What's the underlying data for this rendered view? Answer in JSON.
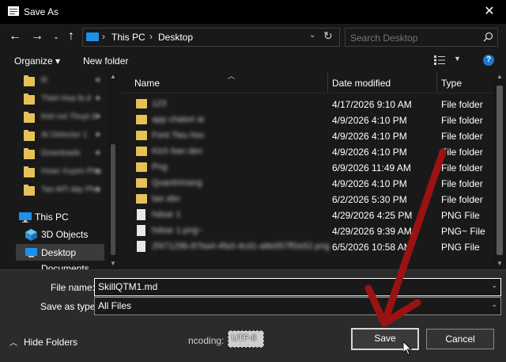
{
  "window": {
    "title": "Save As"
  },
  "nav": {
    "breadcrumb": [
      "This PC",
      "Desktop"
    ],
    "search_placeholder": "Search Desktop"
  },
  "toolbar": {
    "organize": "Organize ▾",
    "new_folder": "New folder"
  },
  "sidebar": {
    "quick_access": [
      {
        "label": "fiI"
      },
      {
        "label": "Thiet Hoa fa d"
      },
      {
        "label": "Kiet noi Thuyt d"
      },
      {
        "label": "AI Detector 1"
      },
      {
        "label": "Downloads"
      },
      {
        "label": "Hoan Xuyen Phu"
      },
      {
        "label": "Tao API day Phu"
      }
    ],
    "items": [
      {
        "label": "This PC",
        "icon": "monitor-icon"
      },
      {
        "label": "3D Objects",
        "icon": "cube-icon"
      },
      {
        "label": "Desktop",
        "icon": "desktop-icon",
        "selected": true
      },
      {
        "label": "Documents",
        "icon": "documents-icon"
      }
    ]
  },
  "list": {
    "columns": [
      "Name",
      "Date modified",
      "Type"
    ],
    "rows": [
      {
        "name": "123",
        "date": "4/17/2026 9:10 AM",
        "type": "File folder",
        "icon": "folder-icon"
      },
      {
        "name": "app chatori ai",
        "date": "4/9/2026 4:10 PM",
        "type": "File folder",
        "icon": "folder-icon"
      },
      {
        "name": "Font Tieu hoc",
        "date": "4/9/2026 4:10 PM",
        "type": "File folder",
        "icon": "folder-icon"
      },
      {
        "name": "Kich ban den",
        "date": "4/9/2026 4:10 PM",
        "type": "File folder",
        "icon": "folder-icon"
      },
      {
        "name": "Png",
        "date": "6/9/2026 11:49 AM",
        "type": "File folder",
        "icon": "folder-icon"
      },
      {
        "name": "Quantrimang",
        "date": "4/9/2026 4:10 PM",
        "type": "File folder",
        "icon": "folder-icon"
      },
      {
        "name": "tao abc",
        "date": "6/2/2026 5:30 PM",
        "type": "File folder",
        "icon": "folder-icon"
      },
      {
        "name": "hdsar 1",
        "date": "4/29/2026 4:25 PM",
        "type": "PNG File",
        "icon": "image-file-icon"
      },
      {
        "name": "hdsar 1.png~",
        "date": "4/29/2026 9:39 AM",
        "type": "PNG~ File",
        "icon": "image-file-icon"
      },
      {
        "name": "2f47129b-87ba4-4fa3-4cd1-a8e957ff2e52.png",
        "date": "6/5/2026 10:58 AM",
        "type": "PNG File",
        "icon": "image-file-icon"
      }
    ]
  },
  "form": {
    "file_name_label": "File name:",
    "file_name_value": "SkillQTM1.md",
    "save_type_label": "Save as type:",
    "save_type_value": "All Files",
    "hide_folders": "Hide Folders",
    "encoding_label": "ncoding:",
    "encoding_value": "UTF-8",
    "save": "Save",
    "cancel": "Cancel"
  },
  "colors": {
    "accent": "#1e7ad0",
    "annotation_arrow": "#9b1212"
  }
}
